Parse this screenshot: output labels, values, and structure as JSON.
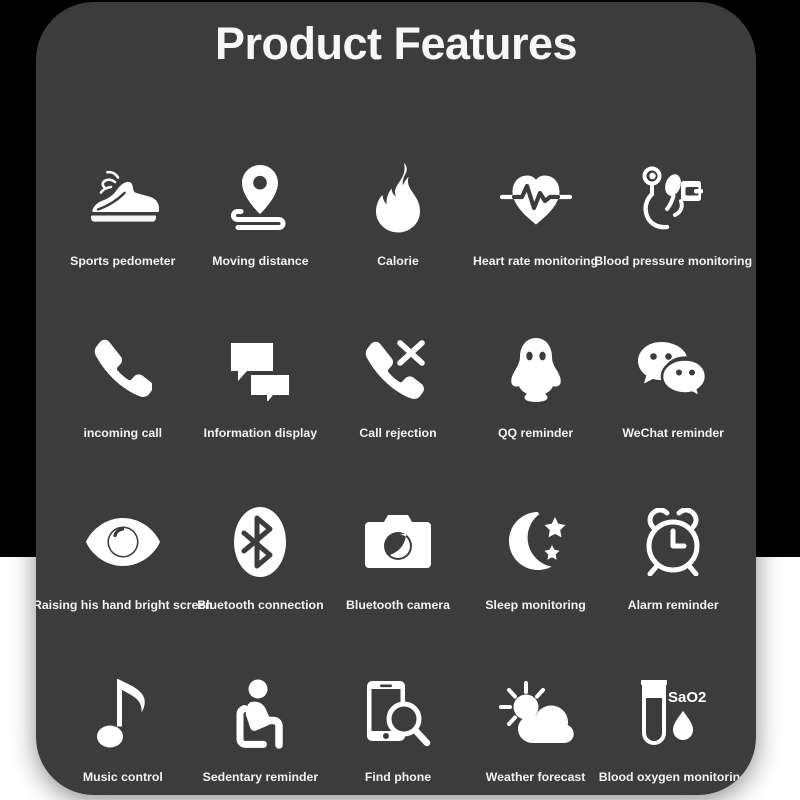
{
  "header": {
    "title": "Product Features"
  },
  "colors": {
    "card_background": "#3c3c3c",
    "icon": "#ffffff",
    "title_text": "#f7f7f7",
    "label_text": "#f2f2f2",
    "backdrop_top": "#000000",
    "backdrop_bottom": "#ffffff"
  },
  "features": {
    "rows": [
      {
        "cells": [
          {
            "label": "Sports pedometer",
            "icon": "running-shoe-icon"
          },
          {
            "label": "Moving distance",
            "icon": "map-pin-icon"
          },
          {
            "label": "Calorie",
            "icon": "flame-icon"
          },
          {
            "label": "Heart rate monitoring",
            "icon": "heart-pulse-icon"
          },
          {
            "label": "Blood pressure monitoring",
            "icon": "blood-pressure-cuff-icon"
          }
        ]
      },
      {
        "cells": [
          {
            "label": "incoming call",
            "icon": "phone-handset-icon"
          },
          {
            "label": "Information display",
            "icon": "speech-bubbles-icon"
          },
          {
            "label": "Call rejection",
            "icon": "phone-reject-icon"
          },
          {
            "label": "QQ reminder",
            "icon": "qq-penguin-icon"
          },
          {
            "label": "WeChat reminder",
            "icon": "wechat-bubbles-icon"
          }
        ]
      },
      {
        "cells": [
          {
            "label": "Raising his hand bright screen",
            "icon": "eye-icon"
          },
          {
            "label": "Bluetooth connection",
            "icon": "bluetooth-icon"
          },
          {
            "label": "Bluetooth camera",
            "icon": "camera-icon"
          },
          {
            "label": "Sleep monitoring",
            "icon": "moon-stars-icon"
          },
          {
            "label": "Alarm reminder",
            "icon": "alarm-clock-icon"
          }
        ]
      },
      {
        "cells": [
          {
            "label": "Music control",
            "icon": "music-note-icon"
          },
          {
            "label": "Sedentary reminder",
            "icon": "seated-person-icon"
          },
          {
            "label": "Find phone",
            "icon": "phone-search-icon"
          },
          {
            "label": "Weather forecast",
            "icon": "sun-cloud-icon"
          },
          {
            "label": "Blood oxygen monitoring",
            "icon": "test-tube-icon",
            "icon_text": "SaO2"
          }
        ]
      }
    ]
  }
}
